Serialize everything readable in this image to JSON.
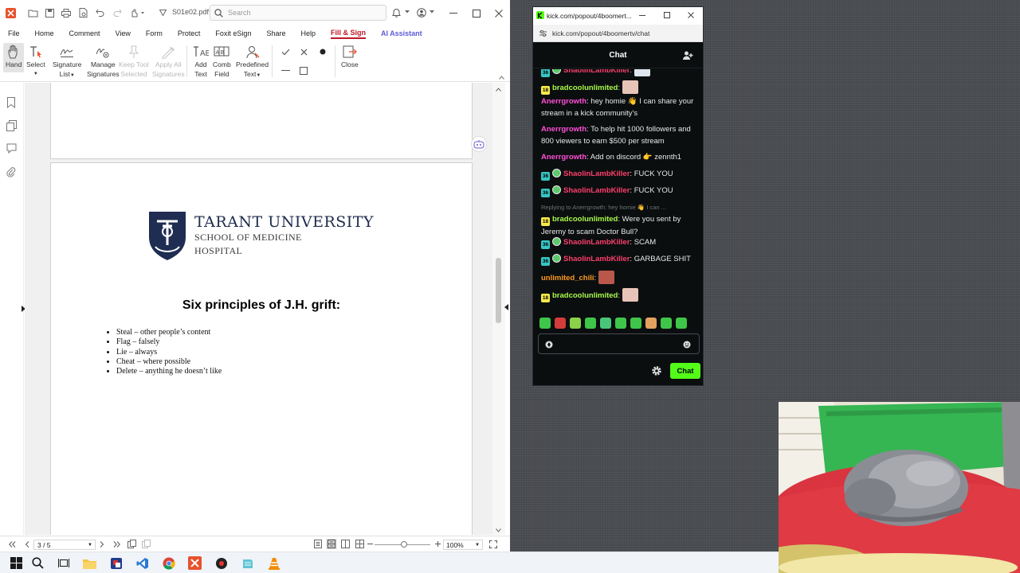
{
  "foxit": {
    "doc_title": "S01e02.pdf",
    "modified_mark": "*",
    "search_placeholder": "Search",
    "menu": [
      "File",
      "Home",
      "Comment",
      "View",
      "Form",
      "Protect",
      "Foxit eSign",
      "Share",
      "Help",
      "Fill & Sign",
      "AI Assistant"
    ],
    "active_menu": "Fill & Sign",
    "ribbon": {
      "hand": "Hand",
      "select": "Select",
      "signature_list": [
        "Signature",
        "List"
      ],
      "manage_signatures": [
        "Manage",
        "Signatures"
      ],
      "keep_tool_selected": [
        "Keep Tool",
        "Selected"
      ],
      "apply_all_signatures": [
        "Apply All",
        "Signatures"
      ],
      "add_text": [
        "Add",
        "Text"
      ],
      "comb_field": [
        "Comb",
        "Field"
      ],
      "predefined_text": [
        "Predefined",
        "Text"
      ],
      "close": "Close"
    },
    "document": {
      "university": "TARANT UNIVERSITY",
      "school_line1": "SCHOOL OF MEDICINE",
      "school_line2": "HOSPITAL",
      "heading": "Six principles of J.H. grift:",
      "list": [
        "Steal – other people’s content",
        "Flag – falsely",
        "Lie – always",
        "Cheat – where possible",
        "Delete – anything he doesn’t like"
      ]
    },
    "status": {
      "page_indicator": "3 / 5",
      "zoom": "100%"
    }
  },
  "kick": {
    "window_title": "kick.com/popout/4boomert...",
    "url": "kick.com/popout/4boomertv/chat",
    "header": "Chat",
    "messages": [
      {
        "badge": "36",
        "sub": true,
        "user": "ShaolinLambKiller",
        "user_color": "#ff3f6c",
        "text": ""
      },
      {
        "badge": "18",
        "sub": false,
        "user": "bradcoolunlimited",
        "user_color": "#a8f94a",
        "text": ""
      },
      {
        "badge": "",
        "sub": false,
        "user": "Anerrgrowth",
        "user_color": "#ff4fd8",
        "text": "hey homie 👋 I can share your stream in a kick community's"
      },
      {
        "badge": "",
        "sub": false,
        "user": "Anerrgrowth",
        "user_color": "#ff4fd8",
        "text": "To help hit 1000 followers and 800 viewers to earn $500 per stream"
      },
      {
        "badge": "",
        "sub": false,
        "user": "Anerrgrowth",
        "user_color": "#ff4fd8",
        "text": "Add on discord 👉 zennth1"
      },
      {
        "badge": "36",
        "sub": true,
        "user": "ShaolinLambKiller",
        "user_color": "#ff3f6c",
        "text": "FUCK YOU"
      },
      {
        "badge": "36",
        "sub": true,
        "user": "ShaolinLambKiller",
        "user_color": "#ff3f6c",
        "text": "FUCK YOU"
      },
      {
        "badge": "18",
        "sub": false,
        "user": "bradcoolunlimited",
        "user_color": "#a8f94a",
        "text": "Were you sent by Jeremy to scam Doctor Bull?",
        "reply": "Replying to Anerrgrowth: hey homie 👋 I can ..."
      },
      {
        "badge": "36",
        "sub": true,
        "user": "ShaolinLambKiller",
        "user_color": "#ff3f6c",
        "text": "SCAM"
      },
      {
        "badge": "36",
        "sub": true,
        "user": "ShaolinLambKiller",
        "user_color": "#ff3f6c",
        "text": "GARBAGE SHIT"
      },
      {
        "badge": "",
        "sub": false,
        "user": "unlimited_chili",
        "user_color": "#ff9a1f",
        "text": ""
      },
      {
        "badge": "18",
        "sub": false,
        "user": "bradcoolunlimited",
        "user_color": "#a8f94a",
        "text": ""
      }
    ],
    "input_placeholder": "",
    "send_label": "Chat",
    "accent": "#53fc18"
  }
}
